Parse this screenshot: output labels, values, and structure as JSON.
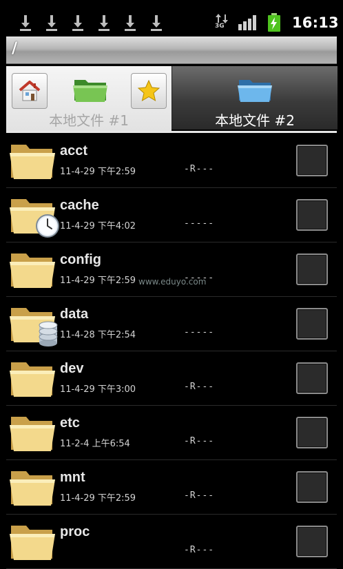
{
  "status_bar": {
    "download_icons": [
      "download-icon",
      "download-icon",
      "download-icon",
      "download-icon",
      "download-icon",
      "download-icon"
    ],
    "network_label": "3G",
    "time": "16:13",
    "colors": {
      "battery": "#4fc31f"
    }
  },
  "path_bar": {
    "path": "/"
  },
  "tabs": [
    {
      "label": "本地文件 #1",
      "active": false
    },
    {
      "label": "本地文件 #2",
      "active": true
    }
  ],
  "files": [
    {
      "name": "acct",
      "date": "11-4-29 下午2:59",
      "perms": "-R---",
      "badge": null
    },
    {
      "name": "cache",
      "date": "11-4-29 下午4:02",
      "perms": "-----",
      "badge": "clock"
    },
    {
      "name": "config",
      "date": "11-4-29 下午2:59",
      "perms": "-----",
      "badge": null
    },
    {
      "name": "data",
      "date": "11-4-28 下午2:54",
      "perms": "-----",
      "badge": "database"
    },
    {
      "name": "dev",
      "date": "11-4-29 下午3:00",
      "perms": "-R---",
      "badge": null
    },
    {
      "name": "etc",
      "date": "11-2-4 上午6:54",
      "perms": "-R---",
      "badge": null
    },
    {
      "name": "mnt",
      "date": "11-4-29 下午2:59",
      "perms": "-R---",
      "badge": null
    },
    {
      "name": "proc",
      "date": "",
      "perms": "-R---",
      "badge": null
    }
  ],
  "watermark": "www.eduyo.com"
}
